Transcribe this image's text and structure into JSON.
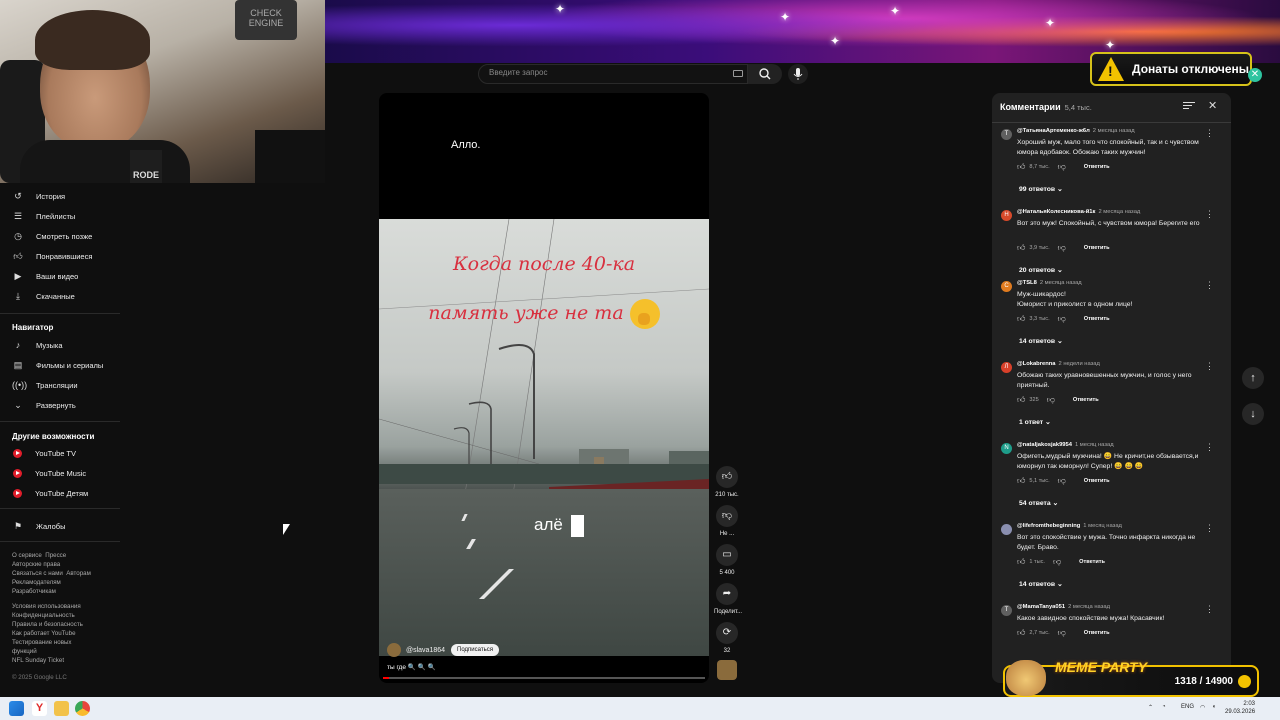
{
  "search": {
    "placeholder": "Введите запрос"
  },
  "donations": {
    "label": "Донаты отключены"
  },
  "webcam": {
    "sign_text": "CHECK ENGINE",
    "mic_label": "RODE"
  },
  "sidebar": {
    "items": [
      {
        "icon": "history-icon",
        "label": "История"
      },
      {
        "icon": "playlist-icon",
        "label": "Плейлисты"
      },
      {
        "icon": "watch-later-icon",
        "label": "Смотреть позже"
      },
      {
        "icon": "thumbs-up-icon",
        "label": "Понравившиеся"
      },
      {
        "icon": "my-videos-icon",
        "label": "Ваши видео"
      },
      {
        "icon": "download-icon",
        "label": "Скачанные"
      }
    ],
    "navigator_heading": "Навигатор",
    "navigator": [
      {
        "icon": "music-icon",
        "label": "Музыка"
      },
      {
        "icon": "movies-icon",
        "label": "Фильмы и сериалы"
      },
      {
        "icon": "live-icon",
        "label": "Трансляции"
      },
      {
        "icon": "chevron-down-icon",
        "label": "Развернуть"
      }
    ],
    "more_heading": "Другие возможности",
    "more": [
      {
        "label": "YouTube TV"
      },
      {
        "label": "YouTube Music"
      },
      {
        "label": "YouTube Детям"
      }
    ],
    "report": {
      "icon": "flag-icon",
      "label": "Жалобы"
    },
    "footer_links_1": [
      "О сервисе",
      "Прессе",
      "Авторские права",
      "Связаться с нами",
      "Авторам",
      "Рекламодателям",
      "Разработчикам"
    ],
    "footer_links_2": [
      "Условия использования",
      "Конфиденциальность",
      "Правила и безопасность",
      "Как работает YouTube",
      "Тестирование новых функций",
      "NFL Sunday Ticket"
    ],
    "copyright": "© 2025 Google LLC"
  },
  "video": {
    "caption_top": "Алло.",
    "overlay_line1": "Когда после 40-ка",
    "overlay_line2": "память уже не та",
    "subtitle": "алё",
    "channel": "@slava1864",
    "subscribe": "Подписаться",
    "description": "ты где 🔍 🔍 🔍",
    "progress": 0.02
  },
  "actions": {
    "likes": "210 тыс.",
    "dislike_label": "Не ...",
    "comments": "5 400",
    "share": "Поделит...",
    "remix": "32"
  },
  "comments": {
    "title": "Комментарии",
    "count": "5,4 тыс.",
    "items": [
      {
        "avatar": "Т",
        "color": "#606060",
        "author": "@ТатьянаАртеменко-ж6л",
        "time": "2 месяца назад",
        "text": "Хороший муж, мало того что спокойный, так и с чувством юмора вдобавок. Обожаю таких мужчин!",
        "likes": "8,7 тыс.",
        "reply": "Ответить",
        "replies": "99 ответов"
      },
      {
        "avatar": "Н",
        "color": "#d84a2a",
        "author": "@НатальяКолесникова-й1к",
        "time": "2 месяца назад",
        "text": "Вот это муж! Спокойный, с чувством юмора! Берегите его",
        "likes": "3,9 тыс.",
        "reply": "Ответить",
        "replies": "20 ответов"
      },
      {
        "avatar": "С",
        "color": "#e07b1f",
        "author": "@TSL8",
        "time": "2 месяца назад",
        "text": "Муж-шикардос!\nЮморист и приколист в одном лице!",
        "likes": "3,3 тыс.",
        "reply": "Ответить",
        "replies": "14 ответов"
      },
      {
        "avatar": "Л",
        "color": "#d8402a",
        "author": "@Lokabrenna",
        "time": "2 недели назад",
        "text": "Обожаю таких уравновешенных мужчин, и голос у него приятный.",
        "likes": "325",
        "reply": "Ответить",
        "replies": "1 ответ"
      },
      {
        "avatar": "N",
        "color": "#1e9d8a",
        "author": "@nataljakosjak9954",
        "time": "1 месяц назад",
        "text": "Офигеть,мудрый мужчина! 😄 Не кричит,не обзывается,и юморнул так юморнул! Супер! 😄 😄 😄",
        "likes": "5,1 тыс.",
        "reply": "Ответить",
        "replies": "54 ответа"
      },
      {
        "avatar": "",
        "color": "#8a8fb0",
        "author": "@lifefromthebeginning",
        "time": "1 месяц назад",
        "text": "Вот это спокойствие у мужа. Точно инфаркта никогда не будет. Браво.",
        "likes": "1 тыс.",
        "reply": "Ответить",
        "replies": "14 ответов"
      },
      {
        "avatar": "Т",
        "color": "#606060",
        "author": "@MamaTanya051",
        "time": "2 месяца назад",
        "text": "Какое завидное спокойствие мужа! Красавчик!",
        "likes": "2,7 тыс.",
        "reply": "Ответить",
        "replies": ""
      }
    ]
  },
  "meme_party": {
    "title": "MEME PARTY",
    "counter": "1318 / 14900"
  },
  "taskbar": {
    "lang": "ENG",
    "time": "2:03",
    "date": "29.03.2026"
  }
}
